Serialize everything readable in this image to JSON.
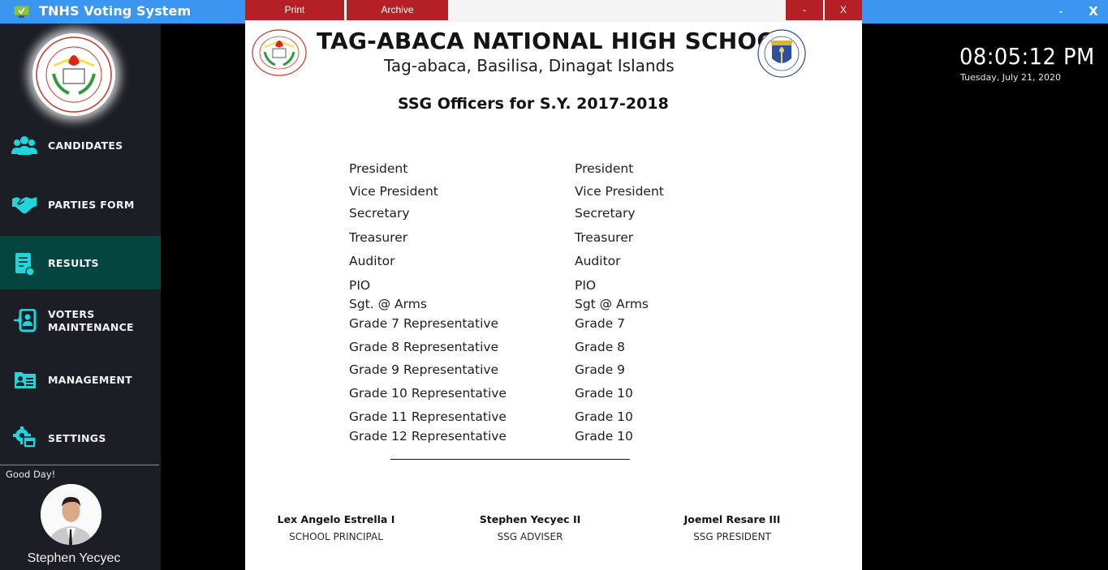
{
  "app": {
    "title": "TNHS Voting System",
    "minimize_label": "-",
    "close_label": "X"
  },
  "sidebar": {
    "items": [
      {
        "label": "CANDIDATES",
        "icon": "users-group-icon",
        "active": false
      },
      {
        "label": "PARTIES FORM",
        "icon": "handshake-icon",
        "active": false
      },
      {
        "label": "RESULTS",
        "icon": "report-document-icon",
        "active": true
      },
      {
        "label": "VOTERS MAINTENANCE",
        "line1": "VOTERS",
        "line2": "MAINTENANCE",
        "icon": "user-login-icon",
        "active": false
      },
      {
        "label": "MANAGEMENT",
        "icon": "id-card-icon",
        "active": false
      },
      {
        "label": "SETTINGS",
        "icon": "gear-window-icon",
        "active": false
      }
    ],
    "greeting": "Good Day!",
    "user_name": "Stephen Yecyec"
  },
  "clock": {
    "time": "08:05:12 PM",
    "date": "Tuesday, July 21, 2020"
  },
  "colors": {
    "titlebar": "#3a96f0",
    "sidebar_bg": "#1b1e24",
    "active_item": "#04463f",
    "icon_accent": "#1ed6dc",
    "dialog_button": "#b52025"
  },
  "dialog": {
    "buttons": {
      "print": "Print",
      "archive": "Archive",
      "minimize": "-",
      "close": "X"
    },
    "report": {
      "school_name": "TAG-ABACA NATIONAL HIGH SCHOOL",
      "school_address": "Tag-abaca, Basilisa, Dinagat Islands",
      "title": "SSG Officers for S.Y.  2017-2018",
      "rows": [
        {
          "position": "President",
          "officer": "President"
        },
        {
          "position": "Vice President",
          "officer": "Vice President"
        },
        {
          "position": "Secretary",
          "officer": "Secretary"
        },
        {
          "position": "Treasurer",
          "officer": "Treasurer"
        },
        {
          "position": "Auditor",
          "officer": "Auditor"
        },
        {
          "position": "PIO",
          "officer": "PIO"
        },
        {
          "position": "Sgt. @ Arms",
          "officer": "Sgt @ Arms"
        },
        {
          "position": "Grade 7 Representative",
          "officer": "Grade 7"
        },
        {
          "position": "Grade 8 Representative",
          "officer": "Grade 8"
        },
        {
          "position": "Grade 9 Representative",
          "officer": "Grade 9"
        },
        {
          "position": "Grade 10 Representative",
          "officer": "Grade 10"
        },
        {
          "position": "Grade 11 Representative",
          "officer": "Grade 10"
        },
        {
          "position": "Grade 12 Representative",
          "officer": "Grade 10"
        }
      ],
      "signatories": [
        {
          "name": "Lex Angelo Estrella I",
          "role": "SCHOOL PRINCIPAL"
        },
        {
          "name": "Stephen Yecyec II",
          "role": "SSG ADVISER"
        },
        {
          "name": "Joemel Resare III",
          "role": "SSG PRESIDENT"
        }
      ]
    }
  }
}
